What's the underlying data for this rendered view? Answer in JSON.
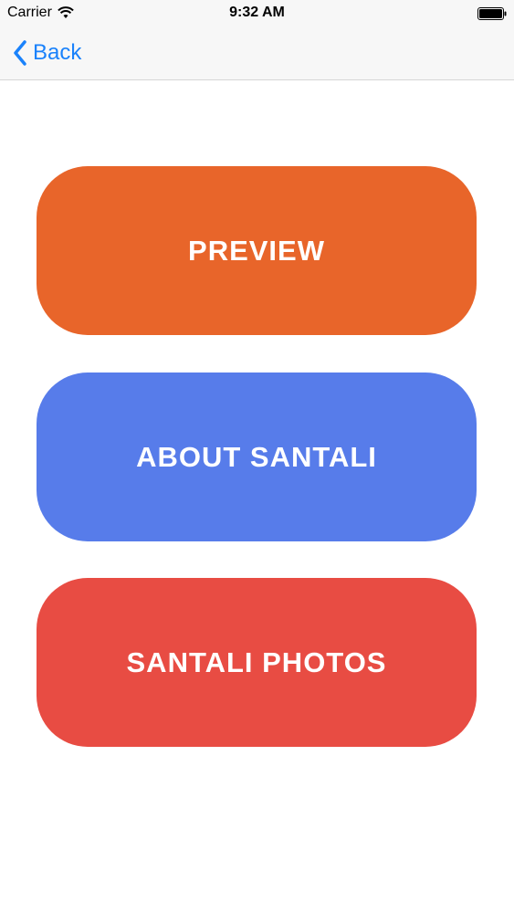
{
  "status_bar": {
    "carrier": "Carrier",
    "time": "9:32 AM",
    "icons": [
      "wifi-icon",
      "battery-icon"
    ]
  },
  "nav": {
    "back_label": "Back",
    "back_icon": "chevron-left-icon"
  },
  "buttons": [
    {
      "label": "PREVIEW",
      "color": "#e8652a"
    },
    {
      "label": "ABOUT SANTALI",
      "color": "#577cea"
    },
    {
      "label": "SANTALI PHOTOS",
      "color": "#e84c43"
    }
  ],
  "colors": {
    "accent": "#1a82fb",
    "bar_background": "#f7f7f7"
  }
}
